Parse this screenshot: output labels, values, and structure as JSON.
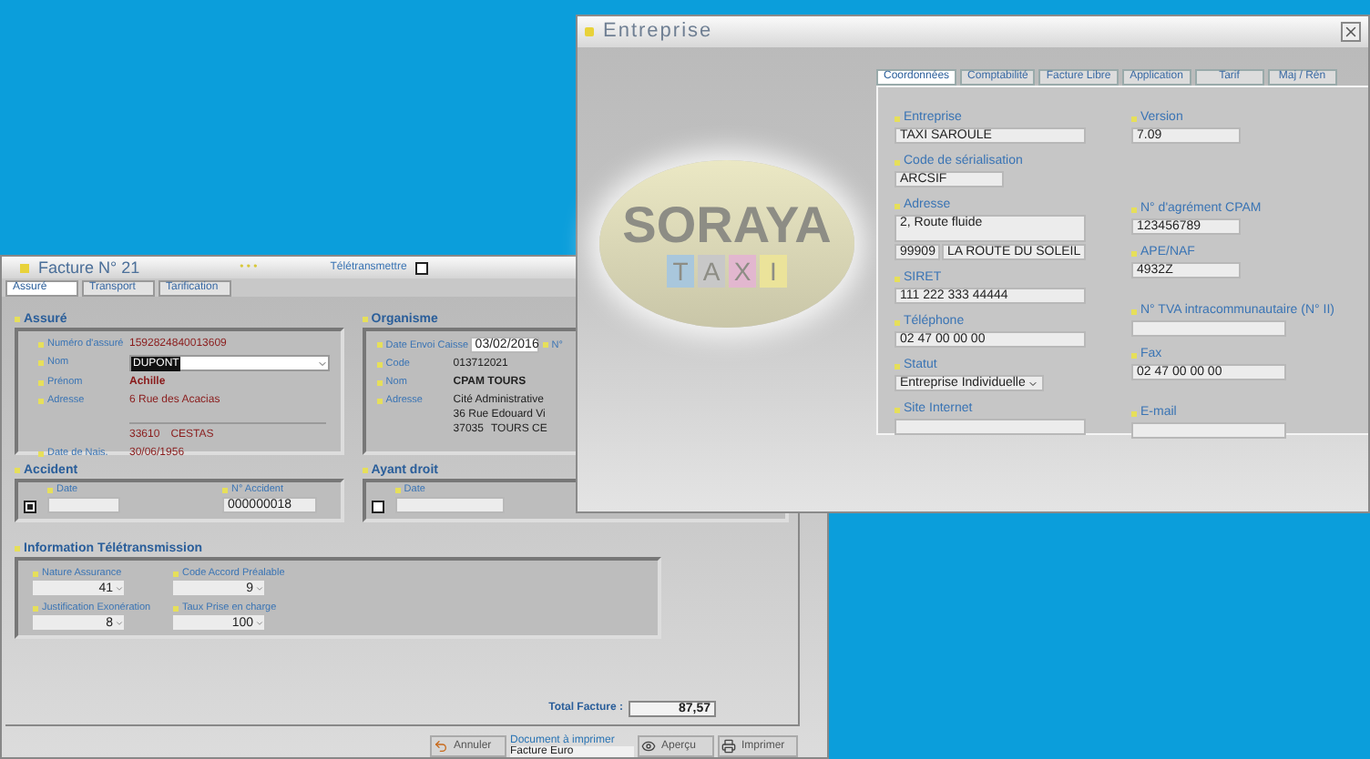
{
  "facture": {
    "title": "Facture N° 21",
    "dots": "• • •",
    "teletransmettre": {
      "label": "Télétransmettre",
      "checked": false
    },
    "tabs": [
      {
        "label": "Assuré",
        "selected": true
      },
      {
        "label": "Transport",
        "selected": false
      },
      {
        "label": "Tarification",
        "selected": false
      }
    ],
    "assure": {
      "title": "Assuré",
      "rows": [
        {
          "kind": "text",
          "label": "Numéro d'assuré",
          "value": "1592824840013609"
        },
        {
          "kind": "select",
          "label": "Nom",
          "value": "DUPONT"
        },
        {
          "kind": "bold",
          "label": "Prénom",
          "value": "Achille"
        },
        {
          "kind": "address",
          "label": "Adresse",
          "value": "6 Rue des Acacias",
          "postcode": "33610",
          "city": "CESTAS"
        },
        {
          "kind": "text",
          "label": "Date de Nais.",
          "value": "30/06/1956"
        }
      ]
    },
    "organisme": {
      "title": "Organisme",
      "date_label": "Date Envoi Caisse",
      "date_value": "03/02/2016",
      "number_label": "N°",
      "rows": [
        {
          "kind": "text",
          "label": "Code",
          "value": "013712021"
        },
        {
          "kind": "bold",
          "label": "Nom",
          "value": "CPAM TOURS"
        },
        {
          "kind": "address",
          "label": "Adresse",
          "lines": [
            "Cité Administrative",
            "36 Rue Edouard Vi"
          ],
          "postcode": "37035",
          "city": "TOURS CE"
        }
      ]
    },
    "accident": {
      "title": "Accident",
      "checked": true,
      "date_label": "Date",
      "number_label": "N° Accident",
      "number_value": "000000018"
    },
    "ayant_droit": {
      "title": "Ayant droit",
      "checked": false,
      "date_label": "Date"
    },
    "teletransmission": {
      "title": "Information Télétransmission",
      "fields": [
        {
          "label": "Nature Assurance",
          "value": "41"
        },
        {
          "label": "Code Accord Préalable",
          "value": "9"
        },
        {
          "label": "Justification Exonération",
          "value": "8"
        },
        {
          "label": "Taux Prise en charge",
          "value": "100"
        }
      ]
    },
    "total": {
      "label": "Total Facture :",
      "value": "87,57"
    },
    "buttons": {
      "cancel": "Annuler",
      "document_label": "Document à imprimer",
      "document_value": "Facture Euro",
      "preview": "Aperçu",
      "print": "Imprimer"
    }
  },
  "entreprise": {
    "title": "Entreprise",
    "logo": {
      "name": "SORAYA",
      "letters": [
        {
          "char": "T",
          "color": "#a9c7dc"
        },
        {
          "char": "A",
          "color": "#c8c8c8"
        },
        {
          "char": "X",
          "color": "#e2b7cf"
        },
        {
          "char": "I",
          "color": "#ebe39a"
        }
      ]
    },
    "tabs": [
      {
        "label": "Coordonnées",
        "selected": true
      },
      {
        "label": "Comptabilité",
        "selected": false
      },
      {
        "label": "Facture Libre",
        "selected": false
      },
      {
        "label": "Application",
        "selected": false
      },
      {
        "label": "Tarif",
        "selected": false
      },
      {
        "label": "Maj / Rén",
        "selected": false
      }
    ],
    "left_fields": [
      {
        "kind": "text",
        "label": "Entreprise",
        "value": "TAXI SAROULE"
      },
      {
        "kind": "short",
        "label": "Code de sérialisation",
        "value": "ARCSIF"
      },
      {
        "kind": "address",
        "label": "Adresse",
        "value": "2, Route fluide",
        "postcode": "99909",
        "city": "LA ROUTE DU SOLEIL"
      },
      {
        "kind": "text",
        "label": "SIRET",
        "value": "111 222 333 44444"
      },
      {
        "kind": "text",
        "label": "Téléphone",
        "value": "02 47 00 00 00"
      },
      {
        "kind": "select",
        "label": "Statut",
        "value": "Entreprise Individuelle"
      },
      {
        "kind": "text",
        "label": "Site Internet"
      }
    ],
    "right_fields": [
      {
        "kind": "short",
        "label": "Version",
        "value": "7.09"
      },
      {
        "kind": "short",
        "label": "N° d'agrément CPAM",
        "value": "123456789"
      },
      {
        "kind": "short",
        "label": "APE/NAF",
        "value": "4932Z"
      },
      {
        "kind": "text",
        "label": "N° TVA intracommunautaire (N° II)"
      },
      {
        "kind": "text",
        "label": "Fax",
        "value": "02 47 00 00 00"
      },
      {
        "kind": "text",
        "label": "E-mail"
      }
    ]
  }
}
